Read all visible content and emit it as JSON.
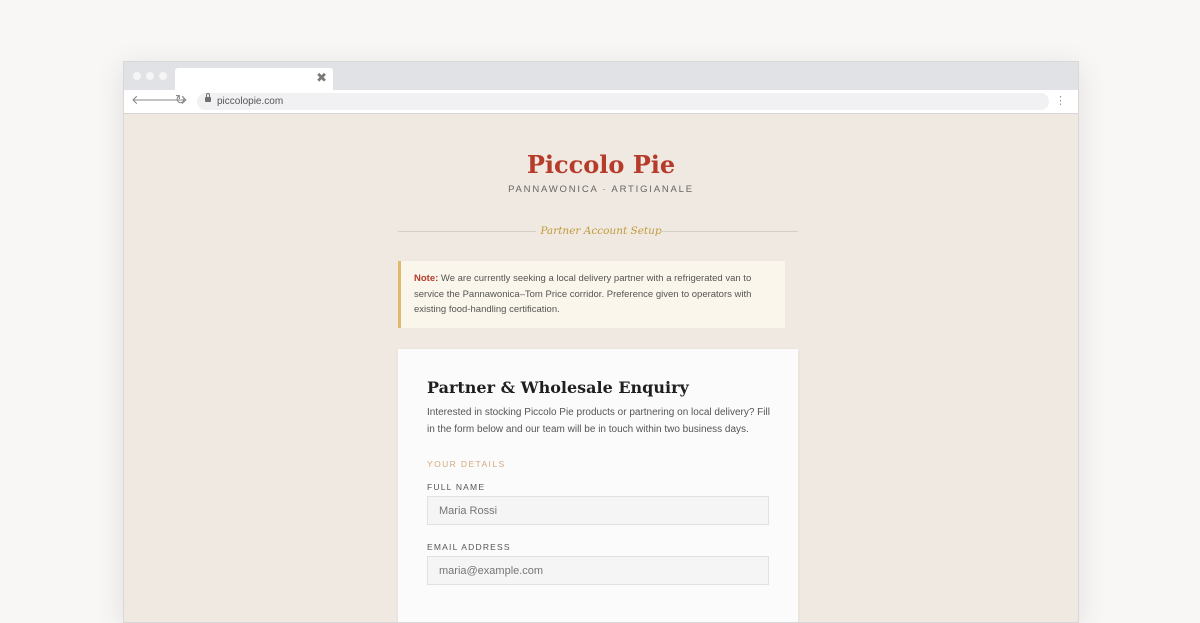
{
  "browser": {
    "tab_close": "✖",
    "url": "piccolopie.com",
    "back_icon": "🡐",
    "forward_icon": "🡒",
    "reload_icon": "↻",
    "menu_icon": "⋮"
  },
  "header": {
    "brand": "Piccolo Pie",
    "tagline": "PANNAWONICA · ARTIGIANALE",
    "section": "Partner Account Setup"
  },
  "notice": {
    "label": "Note:",
    "text": " We are currently seeking a local delivery partner with a refrigerated van to service the Pannawonica–Tom Price corridor. Preference given to operators with existing food-handling certification."
  },
  "form": {
    "title": "Partner & Wholesale Enquiry",
    "description": "Interested in stocking Piccolo Pie products or partnering on local delivery? Fill in the form below and our team will be in touch within two business days.",
    "section_label": "YOUR DETAILS",
    "full_name": {
      "label": "FULL NAME",
      "placeholder": "Maria Rossi"
    },
    "email": {
      "label": "EMAIL ADDRESS",
      "placeholder": "maria@example.com"
    }
  },
  "colors": {
    "brand": "#b63b2a",
    "accent_gold": "#c29a3b",
    "notice_border": "#e0b96a",
    "page_bg": "#efe9e1"
  }
}
